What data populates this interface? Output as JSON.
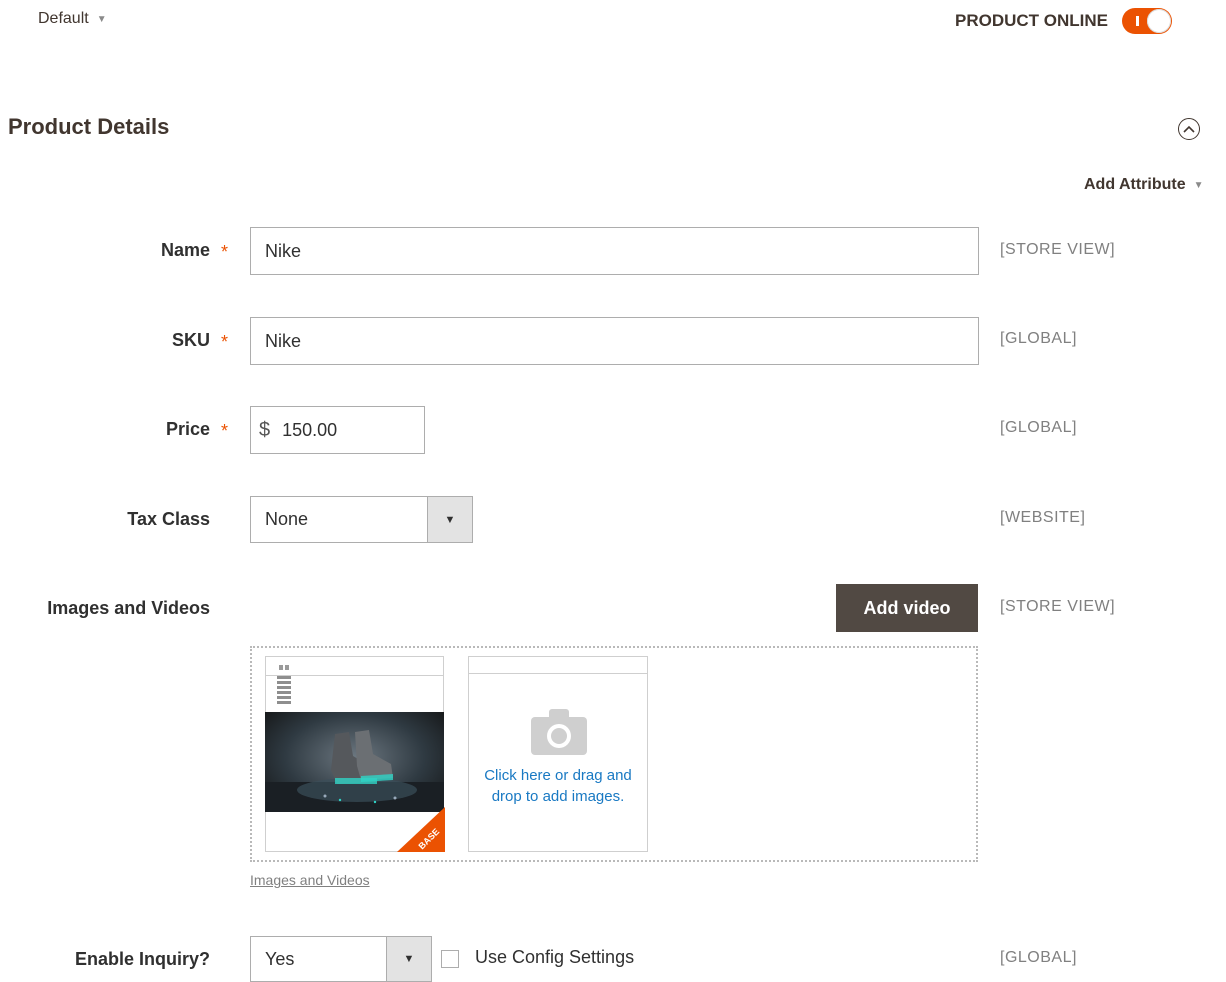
{
  "header": {
    "store_switcher": "Default",
    "product_online_label": "PRODUCT ONLINE",
    "product_online_state": "on"
  },
  "section": {
    "title": "Product Details",
    "add_attribute": "Add Attribute"
  },
  "fields": {
    "name": {
      "label": "Name",
      "value": "Nike",
      "scope": "[STORE VIEW]",
      "required": true
    },
    "sku": {
      "label": "SKU",
      "value": "Nike",
      "scope": "[GLOBAL]",
      "required": true
    },
    "price": {
      "label": "Price",
      "currency": "$",
      "value": "150.00",
      "scope": "[GLOBAL]",
      "required": true
    },
    "tax_class": {
      "label": "Tax Class",
      "value": "None",
      "scope": "[WEBSITE]"
    },
    "images": {
      "label": "Images and Videos",
      "add_video": "Add video",
      "scope": "[STORE VIEW]",
      "base_badge": "BASE",
      "upload_text": "Click here or drag and drop to add images.",
      "link": "Images and Videos"
    },
    "enable_inquiry": {
      "label": "Enable Inquiry?",
      "value": "Yes",
      "use_config": "Use Config Settings",
      "use_config_checked": false,
      "scope": "[GLOBAL]"
    }
  },
  "colors": {
    "accent": "#eb5202",
    "button_dark": "#514943",
    "link": "#1979c3"
  }
}
